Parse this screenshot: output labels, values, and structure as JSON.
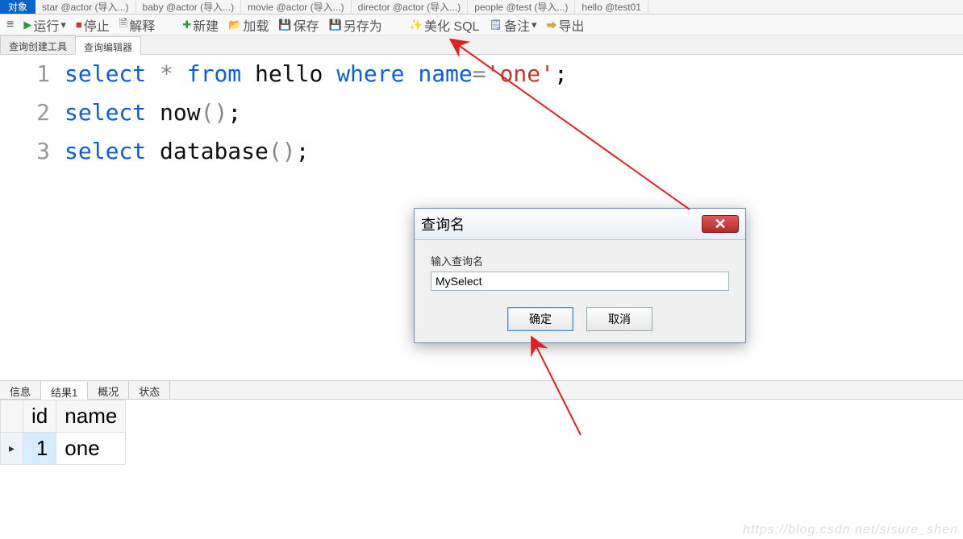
{
  "top_tabs": {
    "selected": "对象",
    "items": [
      "star @actor (导入...)",
      "baby @actor (导入...)",
      "movie @actor (导入...)",
      "director @actor (导入...)",
      "people @test (导入...)",
      "hello @test01"
    ]
  },
  "toolbar": {
    "run": "运行",
    "stop": "停止",
    "explain": "解释",
    "new": "新建",
    "load": "加载",
    "save": "保存",
    "saveas": "另存为",
    "beautify": "美化 SQL",
    "note": "备注",
    "export": "导出"
  },
  "subtabs": {
    "builder": "查询创建工具",
    "editor": "查询编辑器"
  },
  "code": {
    "lines": [
      {
        "no": "1",
        "tokens": [
          {
            "t": "kw",
            "v": "select"
          },
          {
            "t": "sp",
            "v": " "
          },
          {
            "t": "star",
            "v": "*"
          },
          {
            "t": "sp",
            "v": " "
          },
          {
            "t": "kw",
            "v": "from"
          },
          {
            "t": "sp",
            "v": " "
          },
          {
            "t": "id",
            "v": "hello"
          },
          {
            "t": "sp",
            "v": " "
          },
          {
            "t": "kw",
            "v": "where"
          },
          {
            "t": "sp",
            "v": " "
          },
          {
            "t": "kw",
            "v": "name"
          },
          {
            "t": "op",
            "v": "="
          },
          {
            "t": "str",
            "v": "'one'"
          },
          {
            "t": "semi",
            "v": ";"
          }
        ]
      },
      {
        "no": "2",
        "tokens": [
          {
            "t": "kw",
            "v": "select"
          },
          {
            "t": "sp",
            "v": " "
          },
          {
            "t": "id",
            "v": "now"
          },
          {
            "t": "op",
            "v": "()"
          },
          {
            "t": "semi",
            "v": ";"
          }
        ]
      },
      {
        "no": "3",
        "tokens": [
          {
            "t": "kw",
            "v": "select"
          },
          {
            "t": "sp",
            "v": " "
          },
          {
            "t": "id",
            "v": "database"
          },
          {
            "t": "op",
            "v": "()"
          },
          {
            "t": "semi",
            "v": ";"
          }
        ]
      }
    ]
  },
  "result_tabs": {
    "info": "信息",
    "result1": "结果1",
    "profile": "概况",
    "status": "状态"
  },
  "result": {
    "columns": [
      "id",
      "name"
    ],
    "rows": [
      [
        "1",
        "one"
      ]
    ]
  },
  "dialog": {
    "title": "查询名",
    "label": "输入查询名",
    "value": "MySelect",
    "ok": "确定",
    "cancel": "取消"
  },
  "watermark": "https://blog.csdn.net/sisure_shen"
}
